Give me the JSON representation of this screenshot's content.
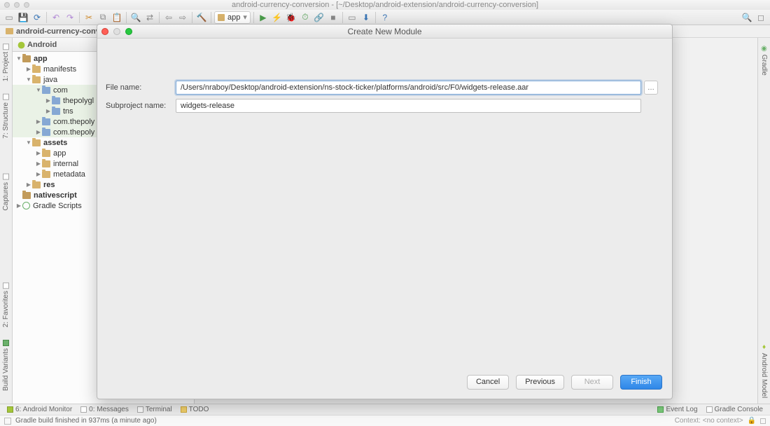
{
  "window": {
    "title": "android-currency-conversion - [~/Desktop/android-extension/android-currency-conversion]"
  },
  "toolbar": {
    "run_config": "app"
  },
  "breadcrumb": {
    "root": "android-currency-conversi"
  },
  "project_tab": {
    "label": "Android"
  },
  "tree": {
    "app": "app",
    "manifests": "manifests",
    "java": "java",
    "com": "com",
    "thepolygl": "thepolygl",
    "tns": "tns",
    "com_thepoly1": "com.thepoly",
    "com_thepoly2": "com.thepoly",
    "assets": "assets",
    "assets_app": "app",
    "internal": "internal",
    "metadata": "metadata",
    "res": "res",
    "nativescript": "nativescript",
    "gradle": "Gradle Scripts"
  },
  "left_tabs": {
    "project": "1: Project",
    "structure": "7: Structure",
    "captures": "Captures",
    "favorites": "2: Favorites",
    "build_variants": "Build Variants"
  },
  "right_tabs": {
    "gradle": "Gradle",
    "android_model": "Android Model"
  },
  "bottom_tools": {
    "monitor": "6: Android Monitor",
    "messages": "0: Messages",
    "terminal": "Terminal",
    "todo": "TODO",
    "eventlog": "Event Log",
    "gradle_console": "Gradle Console"
  },
  "status": {
    "text": "Gradle build finished in 937ms (a minute ago)",
    "context": "Context: <no context>"
  },
  "dialog": {
    "title": "Create New Module",
    "filename_label": "File name:",
    "filename_value": "/Users/nraboy/Desktop/android-extension/ns-stock-ticker/platforms/android/src/F0/widgets-release.aar",
    "subproject_label": "Subproject name:",
    "subproject_value": "widgets-release",
    "cancel": "Cancel",
    "previous": "Previous",
    "next": "Next",
    "finish": "Finish"
  }
}
